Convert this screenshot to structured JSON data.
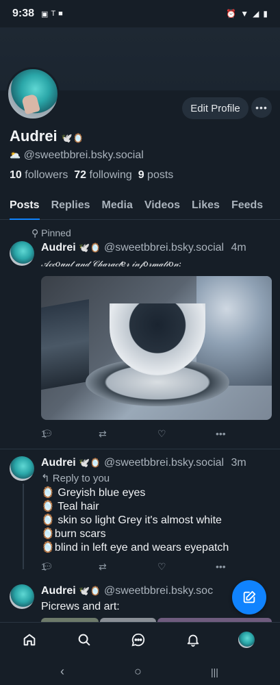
{
  "status_bar": {
    "time": "9:38",
    "icons_left": [
      "photo-icon",
      "t-mobile-icon",
      "app-icon"
    ],
    "icons_right": [
      "alarm-icon",
      "wifi-icon",
      "signal-icon",
      "battery-icon"
    ]
  },
  "profile": {
    "display_name": "Audrei",
    "name_emoji": "🕊️🪞",
    "handle_prefix": "🌥️",
    "handle": "@sweetbbrei.bsky.social",
    "followers_count": "10",
    "followers_label": "followers",
    "following_count": "72",
    "following_label": "following",
    "posts_count": "9",
    "posts_label": "posts",
    "edit_label": "Edit Profile",
    "more_label": "•••"
  },
  "tabs": [
    {
      "label": "Posts",
      "active": true
    },
    {
      "label": "Replies",
      "active": false
    },
    {
      "label": "Media",
      "active": false
    },
    {
      "label": "Videos",
      "active": false
    },
    {
      "label": "Likes",
      "active": false
    },
    {
      "label": "Feeds",
      "active": false
    }
  ],
  "posts": [
    {
      "pinned_label": "Pinned",
      "author": "Audrei",
      "author_emoji": "🕊️🪞",
      "handle": "@sweetbbrei.bsky.social",
      "time": "4m",
      "text": "𝒜𝒸𝒸𝑜𝓊𝓃𝓉 𝒶𝓃𝒹 𝒞𝒽𝒶𝓇𝒶𝒸𝓉𝑒𝓇 𝒾𝓃𝒻𝑜𝓇𝓂𝒶𝓉𝒾𝑜𝓃:",
      "reply_count": "1",
      "more_label": "•••"
    },
    {
      "author": "Audrei",
      "author_emoji": "🕊️🪞",
      "handle": "@sweetbbrei.bsky.social",
      "time": "3m",
      "reply_to": "Reply to you",
      "lines": [
        "🪞 Greyish blue eyes",
        "🪞 Teal hair",
        "🪞 skin so light Grey it's almost white",
        "🪞burn scars",
        "🪞blind in left eye and wears eyepatch"
      ],
      "reply_count": "1",
      "more_label": "•••"
    },
    {
      "author": "Audrei",
      "author_emoji": "🕊️🪞",
      "handle": "@sweetbbrei.bsky.soc",
      "time": "m",
      "text": "Picrews and art:"
    }
  ],
  "colors": {
    "accent": "#1083fe",
    "background": "#161e27",
    "muted": "#aab3bc"
  },
  "nav": [
    "home-icon",
    "search-icon",
    "chat-icon",
    "bell-icon",
    "avatar"
  ],
  "system_nav": {
    "back": "‹",
    "home": "○",
    "recents": "|||"
  }
}
